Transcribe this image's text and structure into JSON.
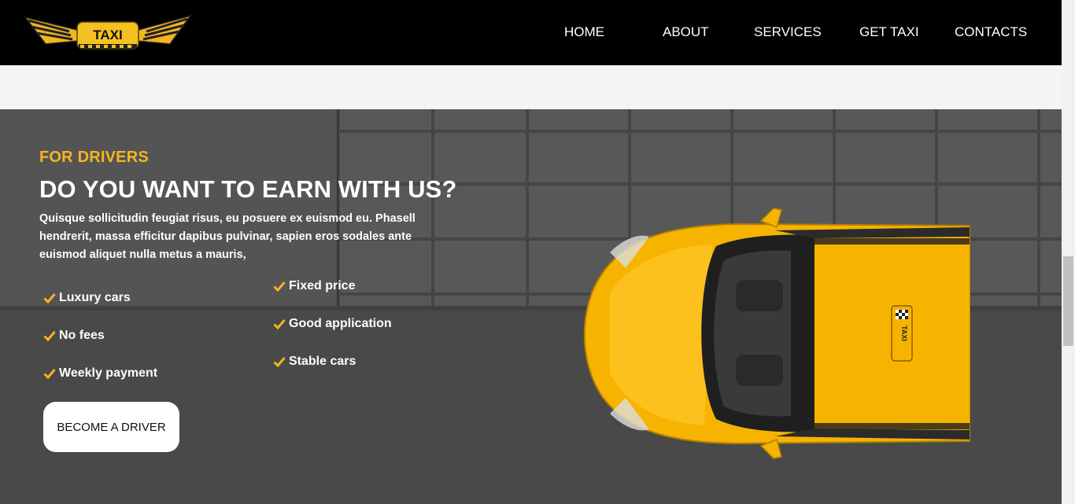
{
  "header": {
    "logo_text": "TAXI",
    "nav": [
      {
        "label": "HOME"
      },
      {
        "label": "ABOUT"
      },
      {
        "label": "SERVICES"
      },
      {
        "label": "GET TAXI"
      },
      {
        "label": "CONTACTS"
      }
    ]
  },
  "hero": {
    "eyebrow": "FOR DRIVERS",
    "headline": "DO YOU WANT TO EARN WITH US?",
    "lead": "Quisque sollicitudin feugiat risus, eu posuere ex euismod eu. Phasell hendrerit, massa efficitur dapibus pulvinar, sapien eros sodales ante euismod aliquet nulla metus a mauris,",
    "features_left": [
      {
        "label": "Luxury cars"
      },
      {
        "label": "No fees"
      },
      {
        "label": "Weekly payment"
      }
    ],
    "features_right": [
      {
        "label": "Fixed price"
      },
      {
        "label": "Good application"
      },
      {
        "label": "Stable cars"
      }
    ],
    "cta_label": "BECOME A DRIVER",
    "car_roof_sign": "TAXI"
  },
  "colors": {
    "accent": "#f5b51f",
    "header_bg": "#000000",
    "hero_bg": "#4e4e4e"
  },
  "icons": {
    "feature_icon": "check-icon",
    "logo": "taxi-winged-logo"
  }
}
